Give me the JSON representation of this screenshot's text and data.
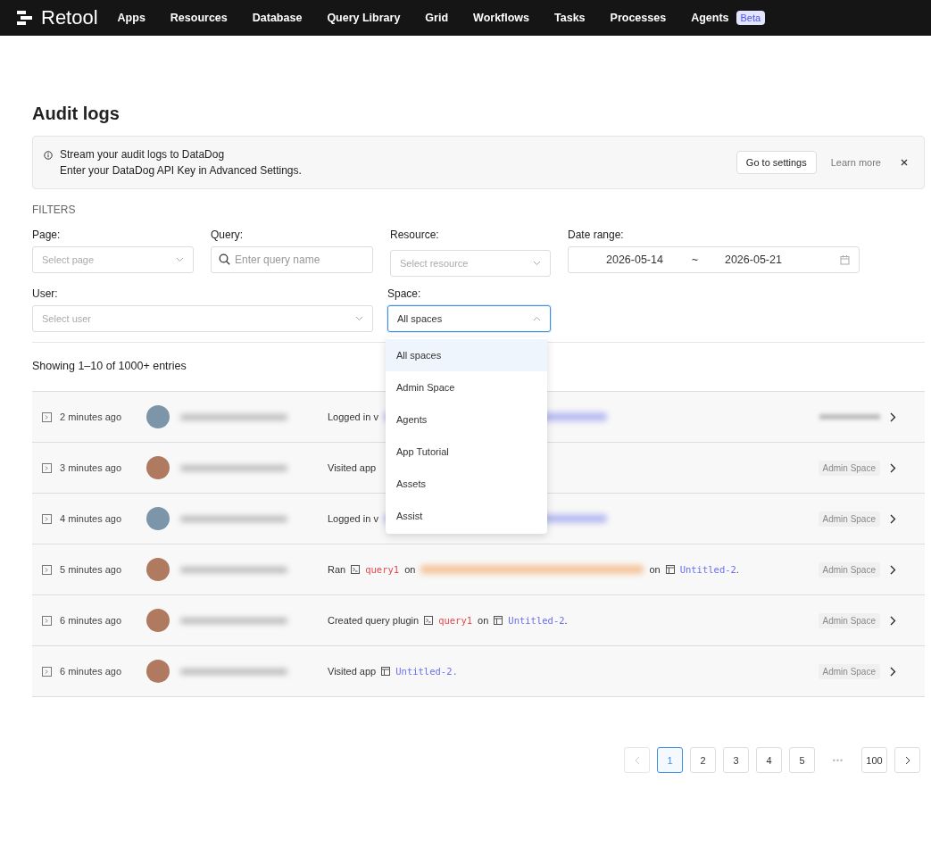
{
  "nav": {
    "brand": "Retool",
    "items": [
      {
        "label": "Apps"
      },
      {
        "label": "Resources"
      },
      {
        "label": "Database"
      },
      {
        "label": "Query Library"
      },
      {
        "label": "Grid"
      },
      {
        "label": "Workflows"
      },
      {
        "label": "Tasks"
      },
      {
        "label": "Processes"
      },
      {
        "label": "Agents",
        "badge": "Beta"
      }
    ]
  },
  "page_title": "Audit logs",
  "banner": {
    "title": "Stream your audit logs to DataDog",
    "message": "Enter your DataDog API Key in Advanced Settings.",
    "button": "Go to settings",
    "link": "Learn more"
  },
  "filters": {
    "heading": "FILTERS",
    "fields": [
      {
        "label": "Page:",
        "kind": "select",
        "placeholder": "Select page"
      },
      {
        "label": "Query:",
        "kind": "search",
        "placeholder": "Enter query name"
      },
      {
        "label": "Resource:",
        "kind": "select",
        "placeholder": "Select resource"
      },
      {
        "label": "Date range:",
        "kind": "daterange",
        "start": "2026-05-14",
        "separator": "~",
        "end": "2026-05-21"
      },
      {
        "label": "User:",
        "kind": "select",
        "placeholder": "Select user"
      },
      {
        "label": "Space:",
        "kind": "select",
        "value": "All spaces",
        "expanded": true,
        "options": [
          {
            "label": "All spaces",
            "selected": true
          },
          {
            "label": "Admin Space",
            "selected": false
          },
          {
            "label": "Agents",
            "selected": false
          },
          {
            "label": "App Tutorial",
            "selected": false
          },
          {
            "label": "Assets",
            "selected": false
          },
          {
            "label": "Assist",
            "selected": false
          }
        ]
      }
    ]
  },
  "summary": "Showing 1–10 of 1000+ entries",
  "rows": [
    {
      "time": "2 minutes ago",
      "avatar": {
        "color": "#7d95a8"
      },
      "action": [
        {
          "kind": "text",
          "text": "Logged in v"
        },
        {
          "kind": "redacted",
          "color": "#b9bdf2"
        }
      ],
      "space": {
        "kind": "redacted"
      }
    },
    {
      "time": "3 minutes ago",
      "avatar": {
        "color": "#b07a60"
      },
      "action": [
        {
          "kind": "text",
          "text": "Visited app"
        }
      ],
      "space": {
        "kind": "label",
        "text": "Admin Space"
      }
    },
    {
      "time": "4 minutes ago",
      "avatar": {
        "color": "#7d95a8"
      },
      "action": [
        {
          "kind": "text",
          "text": "Logged in v"
        },
        {
          "kind": "redacted",
          "color": "#b9bdf2"
        }
      ],
      "space": {
        "kind": "label",
        "text": "Admin Space"
      }
    },
    {
      "time": "5 minutes ago",
      "avatar": {
        "color": "#b07a60"
      },
      "action": [
        {
          "kind": "text",
          "text": "Ran"
        },
        {
          "kind": "query",
          "text": "query1"
        },
        {
          "kind": "text",
          "text": "on"
        },
        {
          "kind": "redacted",
          "color": "#f5c59c"
        },
        {
          "kind": "text",
          "text": "on"
        },
        {
          "kind": "app",
          "text": "Untitled-2"
        },
        {
          "kind": "punct",
          "text": "."
        }
      ],
      "space": {
        "kind": "label",
        "text": "Admin Space"
      }
    },
    {
      "time": "6 minutes ago",
      "avatar": {
        "color": "#b07a60"
      },
      "action": [
        {
          "kind": "text",
          "text": "Created query plugin"
        },
        {
          "kind": "query",
          "text": "query1"
        },
        {
          "kind": "text",
          "text": "on"
        },
        {
          "kind": "app",
          "text": "Untitled-2"
        },
        {
          "kind": "punct",
          "text": "."
        }
      ],
      "space": {
        "kind": "label",
        "text": "Admin Space"
      }
    },
    {
      "time": "6 minutes ago",
      "avatar": {
        "color": "#b07a60"
      },
      "action": [
        {
          "kind": "text",
          "text": "Visited app"
        },
        {
          "kind": "app",
          "text": "Untitled-2."
        }
      ],
      "space": {
        "kind": "label",
        "text": "Admin Space"
      }
    }
  ],
  "pagination": {
    "prev_disabled": true,
    "pages": [
      {
        "kind": "page",
        "label": "1",
        "selected": true
      },
      {
        "kind": "page",
        "label": "2",
        "selected": false
      },
      {
        "kind": "page",
        "label": "3",
        "selected": false
      },
      {
        "kind": "page",
        "label": "4",
        "selected": false
      },
      {
        "kind": "page",
        "label": "5",
        "selected": false
      },
      {
        "kind": "ellipsis",
        "label": "•••"
      },
      {
        "kind": "page",
        "label": "100",
        "selected": false
      }
    ]
  }
}
